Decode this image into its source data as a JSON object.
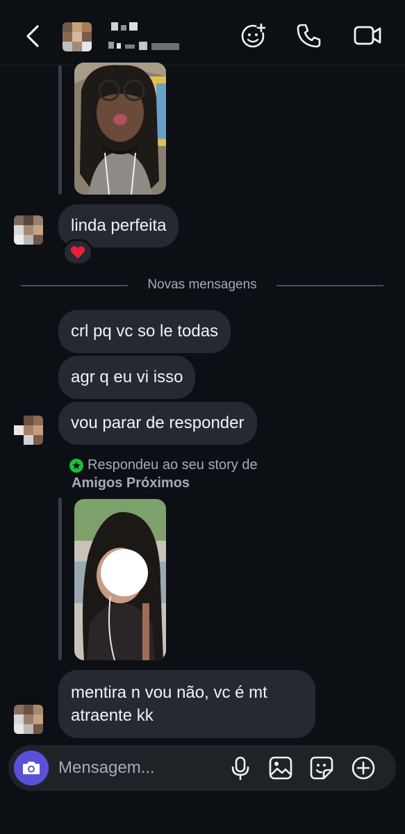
{
  "header": {
    "back_icon": "chevron-left-icon",
    "avatar": "pixelated-profile-photo",
    "contact_name": "",
    "actions": [
      "sparkle-face-icon",
      "phone-icon",
      "video-camera-icon"
    ]
  },
  "thread": {
    "messages": [
      {
        "text": "linda perfeita",
        "reaction": "❤️"
      },
      {
        "text": "crl pq vc so le todas"
      },
      {
        "text": "agr q eu vi isso"
      },
      {
        "text": "vou parar de responder"
      },
      {
        "text": "mentira n vou não, vc é mt atraente kk"
      }
    ],
    "divider_label": "Novas mensagens",
    "reply_note": {
      "line1": "Respondeu ao seu story de",
      "line2": "Amigos Próximos"
    }
  },
  "composer": {
    "placeholder": "Mensagem...",
    "camera_icon": "camera-icon",
    "actions": [
      "microphone-icon",
      "image-icon",
      "sticker-icon",
      "plus-icon"
    ]
  },
  "colors": {
    "background": "#0c0f14",
    "bubble": "#262930",
    "camera_button": "#5b51d8",
    "close_friends_badge": "#1bbf3a"
  }
}
